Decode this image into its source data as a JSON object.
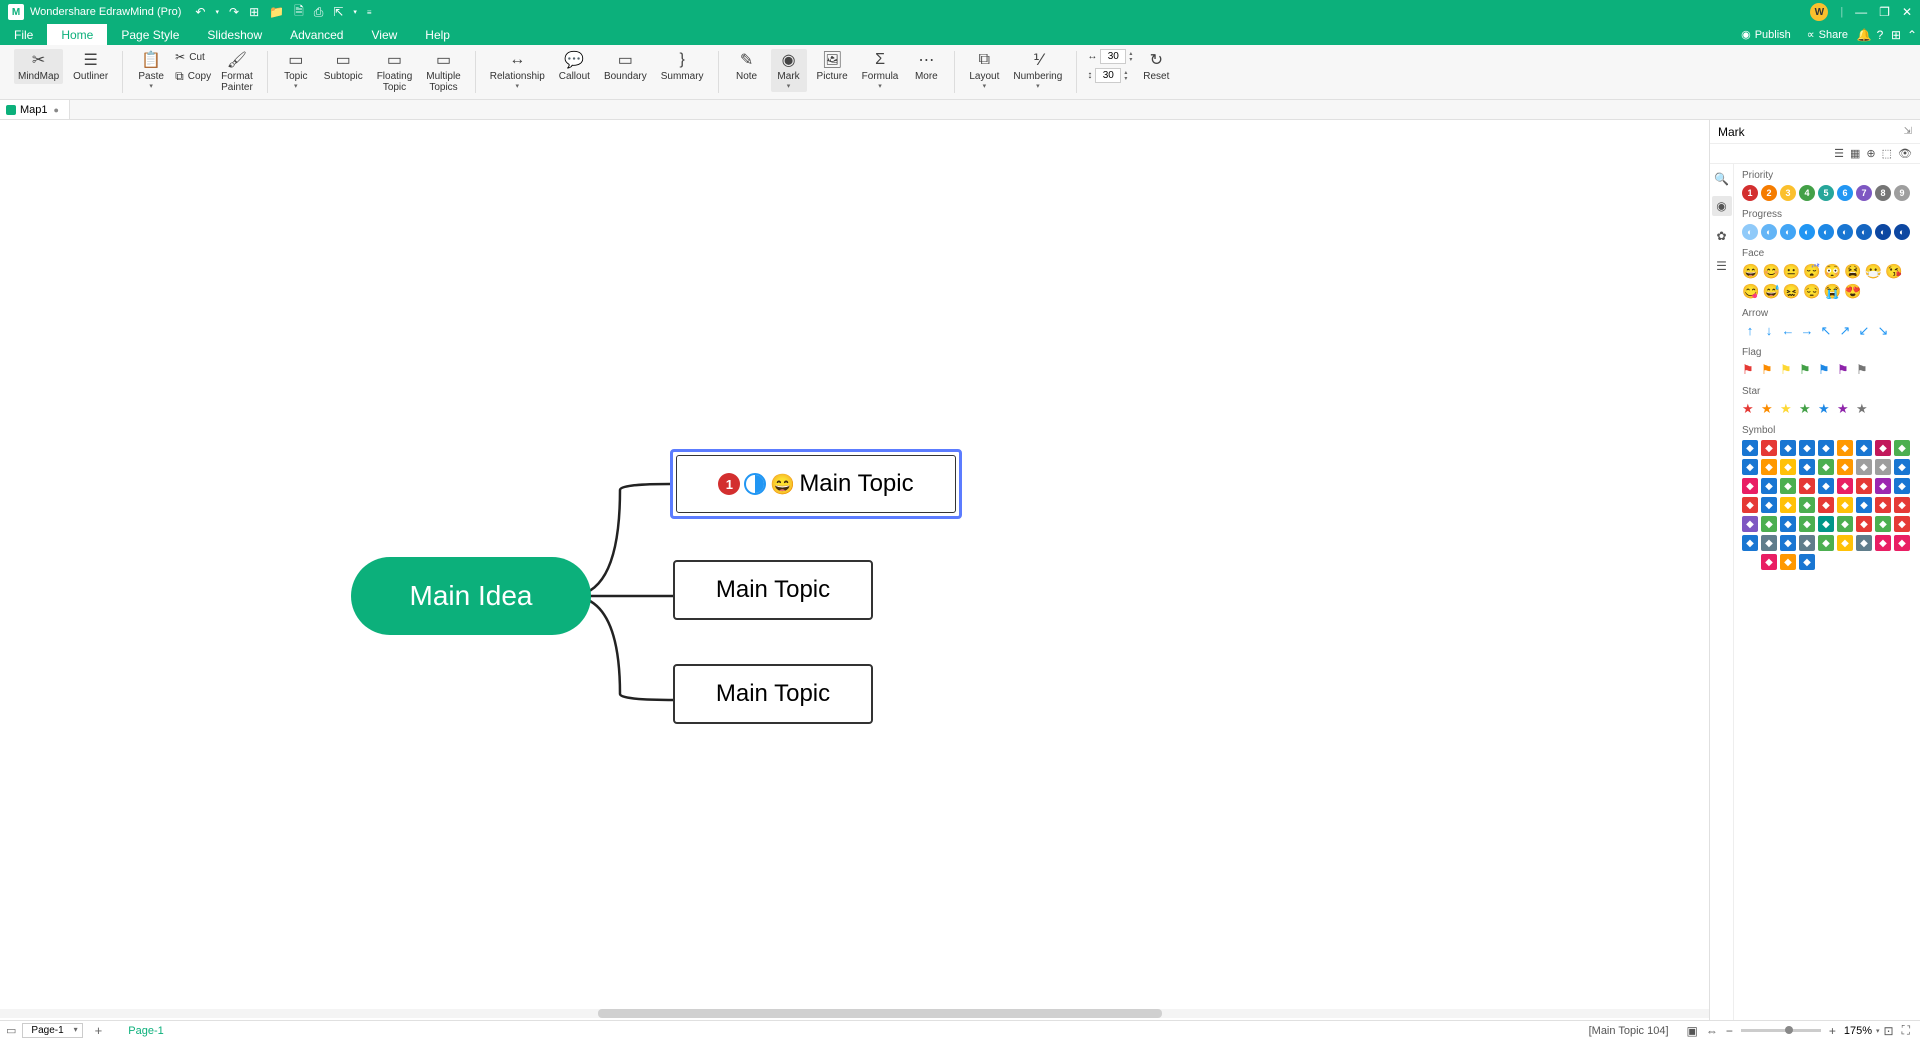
{
  "title": "Wondershare EdrawMind (Pro)",
  "avatar": "W",
  "menus": [
    "File",
    "Home",
    "Page Style",
    "Slideshow",
    "Advanced",
    "View",
    "Help"
  ],
  "activeMenu": "Home",
  "share": {
    "publish": "Publish",
    "share": "Share"
  },
  "ribbon": {
    "mindmap": "MindMap",
    "outliner": "Outliner",
    "paste": "Paste",
    "cut": "Cut",
    "copy": "Copy",
    "formatpainter": "Format\nPainter",
    "topic": "Topic",
    "subtopic": "Subtopic",
    "floating": "Floating\nTopic",
    "multiple": "Multiple\nTopics",
    "relationship": "Relationship",
    "callout": "Callout",
    "boundary": "Boundary",
    "summary": "Summary",
    "note": "Note",
    "mark": "Mark",
    "picture": "Picture",
    "formula": "Formula",
    "more": "More",
    "layout": "Layout",
    "numbering": "Numbering",
    "width": "30",
    "height": "30",
    "reset": "Reset"
  },
  "doctab": "Map1",
  "mindmap": {
    "main": "Main Idea",
    "t1": "Main Topic",
    "t2": "Main Topic",
    "t3": "Main Topic",
    "t1_priority": "1",
    "t1_face": "😄"
  },
  "rightpanel": {
    "title": "Mark",
    "sections": {
      "priority": "Priority",
      "progress": "Progress",
      "face": "Face",
      "arrow": "Arrow",
      "flag": "Flag",
      "star": "Star",
      "symbol": "Symbol"
    },
    "priorities": [
      "1",
      "2",
      "3",
      "4",
      "5",
      "6",
      "7",
      "8",
      "9"
    ],
    "priorityColors": [
      "#d32f2f",
      "#f57c00",
      "#fbc02d",
      "#43a047",
      "#26a69a",
      "#2196f3",
      "#7e57c2",
      "#757575",
      "#9e9e9e"
    ],
    "progressColors": [
      "#90caf9",
      "#64b5f6",
      "#42a5f5",
      "#2196f3",
      "#1e88e5",
      "#1976d2",
      "#1565c0",
      "#0d47a1",
      "#0d47a1"
    ],
    "faces": [
      "😄",
      "😊",
      "😐",
      "😴",
      "😳",
      "😫",
      "😷",
      "😘",
      "😋",
      "😅",
      "😖",
      "😔",
      "😭",
      "😍"
    ],
    "arrows": [
      "↑",
      "↓",
      "←",
      "→",
      "↖",
      "↗",
      "↙",
      "↘"
    ],
    "flagColors": [
      "#e53935",
      "#fb8c00",
      "#fdd835",
      "#43a047",
      "#1e88e5",
      "#8e24aa",
      "#757575"
    ],
    "starColors": [
      "#e53935",
      "#fb8c00",
      "#fdd835",
      "#43a047",
      "#1e88e5",
      "#8e24aa",
      "#757575"
    ],
    "symbolColors": [
      "#1976d2",
      "#e53935",
      "#1976d2",
      "#1976d2",
      "#1976d2",
      "#ff9800",
      "#1976d2",
      "#c2185b",
      "#4caf50",
      "#1976d2",
      "#ff9800",
      "#ffc107",
      "#1976d2",
      "#4caf50",
      "#ff9800",
      "#9e9e9e",
      "#9e9e9e",
      "#1976d2",
      "#e91e63",
      "#1976d2",
      "#4caf50",
      "#e53935",
      "#1976d2",
      "#e91e63",
      "#e53935",
      "#9c27b0",
      "#1976d2",
      "#e53935",
      "#1976d2",
      "#ffc107",
      "#4caf50",
      "#e53935",
      "#ffc107",
      "#1976d2",
      "#e53935",
      "#e53935",
      "#7e57c2",
      "#4caf50",
      "#1976d2",
      "#4caf50",
      "#009688",
      "#4caf50",
      "#e53935",
      "#4caf50",
      "#e53935",
      "#1976d2",
      "#607d8b",
      "#1976d2",
      "#607d8b",
      "#4caf50",
      "#ffc107",
      "#607d8b",
      "#e91e63",
      "#e91e63",
      "#fff",
      "#e91e63",
      "#ff9800",
      "#1976d2"
    ]
  },
  "status": {
    "page": "Page-1",
    "pagetab": "Page-1",
    "selection": "[Main Topic 104]",
    "zoom": "175%"
  }
}
